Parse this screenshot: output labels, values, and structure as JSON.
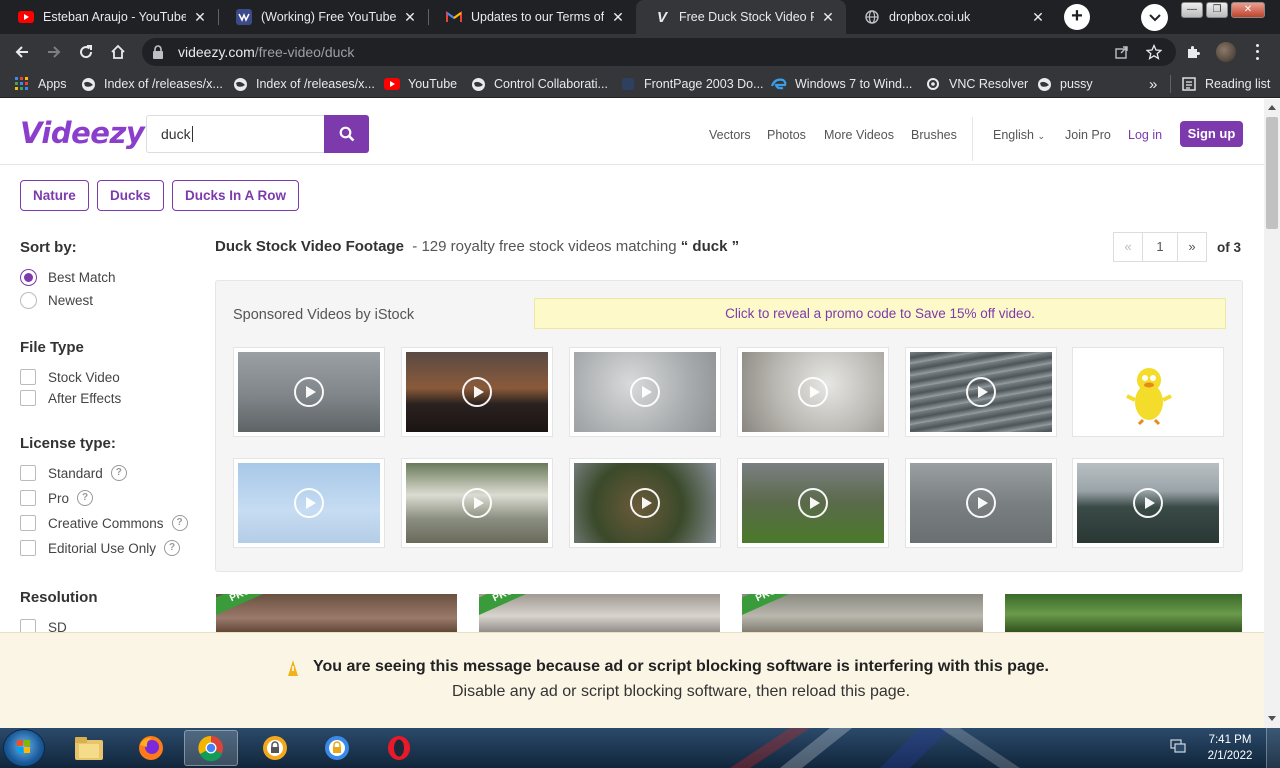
{
  "browser": {
    "tabs": [
      {
        "title": "Esteban Araujo - YouTube",
        "icon": "youtube-icon"
      },
      {
        "title": "(Working) Free YouTube Pr",
        "icon": "app-icon"
      },
      {
        "title": "Updates to our Terms of Se",
        "icon": "gmail-icon"
      },
      {
        "title": "Free Duck Stock Video Foot",
        "icon": "videezy-icon",
        "active": true
      },
      {
        "title": "dropbox.coi.uk",
        "icon": "globe-icon"
      }
    ],
    "url_host": "videezy.com",
    "url_path": "/free-video/duck",
    "bookmarks": [
      {
        "label": "Apps",
        "icon": "apps-grid-icon"
      },
      {
        "label": "Index of /releases/x...",
        "icon": "globe-icon"
      },
      {
        "label": "Index of /releases/x...",
        "icon": "globe-icon"
      },
      {
        "label": "YouTube",
        "icon": "youtube-icon"
      },
      {
        "label": "Control Collaborati...",
        "icon": "globe-icon"
      },
      {
        "label": "FrontPage 2003 Do...",
        "icon": "page-icon"
      },
      {
        "label": "Windows 7 to Wind...",
        "icon": "edge-icon"
      },
      {
        "label": "VNC Resolver",
        "icon": "vnc-icon"
      },
      {
        "label": "pussy",
        "icon": "globe-icon"
      }
    ],
    "bookmarks_overflow": "»",
    "reading_list": "Reading list"
  },
  "site": {
    "logo": "Videezy",
    "search_value": "duck",
    "nav": [
      "Vectors",
      "Photos",
      "More Videos",
      "Brushes"
    ],
    "language": "English",
    "join_pro": "Join Pro",
    "login": "Log in",
    "signup": "Sign up",
    "accent_color": "#7c3aad"
  },
  "chips": [
    "Nature",
    "Ducks",
    "Ducks In A Row"
  ],
  "sidebar": {
    "sort_heading": "Sort by:",
    "sort_options": [
      {
        "label": "Best Match",
        "selected": true
      },
      {
        "label": "Newest",
        "selected": false
      }
    ],
    "file_type_heading": "File Type",
    "file_types": [
      "Stock Video",
      "After Effects"
    ],
    "license_heading": "License type:",
    "licenses": [
      "Standard",
      "Pro",
      "Creative Commons",
      "Editorial Use Only"
    ],
    "resolution_heading": "Resolution",
    "resolutions": [
      "SD"
    ]
  },
  "results": {
    "title": "Duck Stock Video Footage",
    "subtitle_prefix": "- 129 royalty free stock videos matching",
    "query_display": "“ duck ”",
    "page_current": "1",
    "page_prev": "«",
    "page_next": "»",
    "page_of": "of 3"
  },
  "sponsored": {
    "label": "Sponsored Videos by iStock",
    "promo": "Click to reveal a promo code to Save 15% off video."
  },
  "pro_badge": "PRO",
  "adblock": {
    "line1": "You are seeing this message because ad or script blocking software is interfering with this page.",
    "line2": "Disable any ad or script blocking software, then reload this page."
  },
  "taskbar": {
    "time": "7:41 PM",
    "date": "2/1/2022"
  }
}
